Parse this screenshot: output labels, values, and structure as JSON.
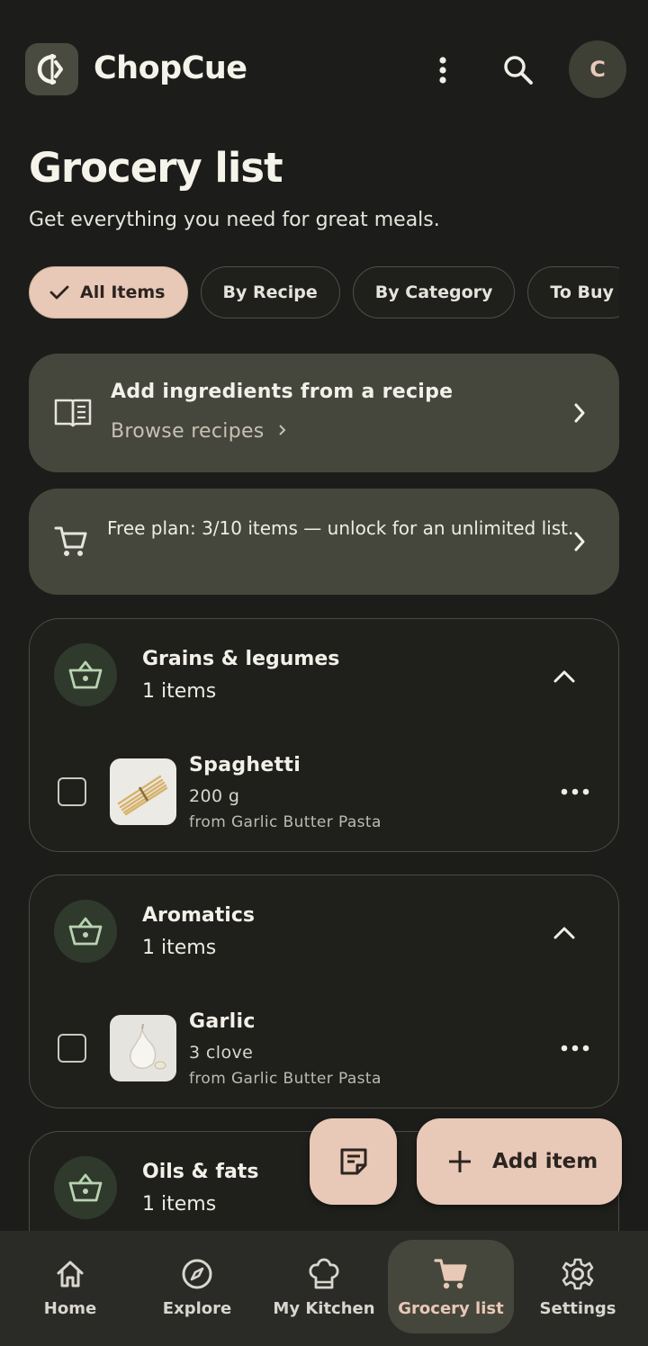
{
  "app": {
    "name": "ChopCue",
    "avatar_initial": "C"
  },
  "page": {
    "title": "Grocery list",
    "subtitle": "Get everything you need for great meals."
  },
  "filters": [
    {
      "label": "All Items",
      "active": true
    },
    {
      "label": "By Recipe",
      "active": false
    },
    {
      "label": "By Category",
      "active": false
    },
    {
      "label": "To Buy",
      "active": false
    }
  ],
  "recipe_card": {
    "icon": "book-icon",
    "title": "Add ingredients from a recipe",
    "link": "Browse recipes"
  },
  "plan_card": {
    "icon": "cart-icon",
    "text": "Free plan: 3/10 items — unlock for an unlimited list."
  },
  "sections": [
    {
      "title": "Grains & legumes",
      "count": "1 items",
      "items": [
        {
          "name": "Spaghetti",
          "qty": "200 g",
          "source": "from Garlic Butter Pasta",
          "checked": false
        }
      ]
    },
    {
      "title": "Aromatics",
      "count": "1 items",
      "items": [
        {
          "name": "Garlic",
          "qty": "3 clove",
          "source": "from Garlic Butter Pasta",
          "checked": false
        }
      ]
    },
    {
      "title": "Oils & fats",
      "count": "1 items",
      "items": []
    }
  ],
  "fab": {
    "add_label": "Add item"
  },
  "nav": [
    {
      "label": "Home",
      "icon": "home-icon",
      "active": false
    },
    {
      "label": "Explore",
      "icon": "compass-icon",
      "active": false
    },
    {
      "label": "My Kitchen",
      "icon": "chef-hat-icon",
      "active": false
    },
    {
      "label": "Grocery list",
      "icon": "cart-icon",
      "active": true
    },
    {
      "label": "Settings",
      "icon": "gear-icon",
      "active": false
    }
  ],
  "colors": {
    "background": "#1c1d1a",
    "accent": "#e8c8b6",
    "card": "#46473c",
    "section_icon_bg": "#2f3a2c"
  }
}
